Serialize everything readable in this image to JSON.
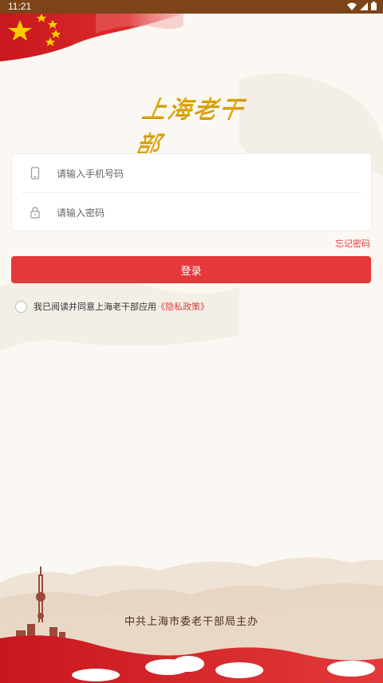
{
  "status_bar": {
    "time": "11:21"
  },
  "logo": {
    "text": "上海老干部"
  },
  "form": {
    "phone_placeholder": "请输入手机号码",
    "password_placeholder": "请输入密码"
  },
  "forgot_password": "忘记密码",
  "login_button": "登录",
  "agreement": {
    "text": "我已阅读并同意上海老干部应用",
    "policy_link": "《隐私政策》"
  },
  "footer": {
    "org": "中共上海市委老干部局主办"
  },
  "colors": {
    "accent": "#e5383b",
    "statusbar": "#7c4418",
    "link": "#e03c3c"
  }
}
